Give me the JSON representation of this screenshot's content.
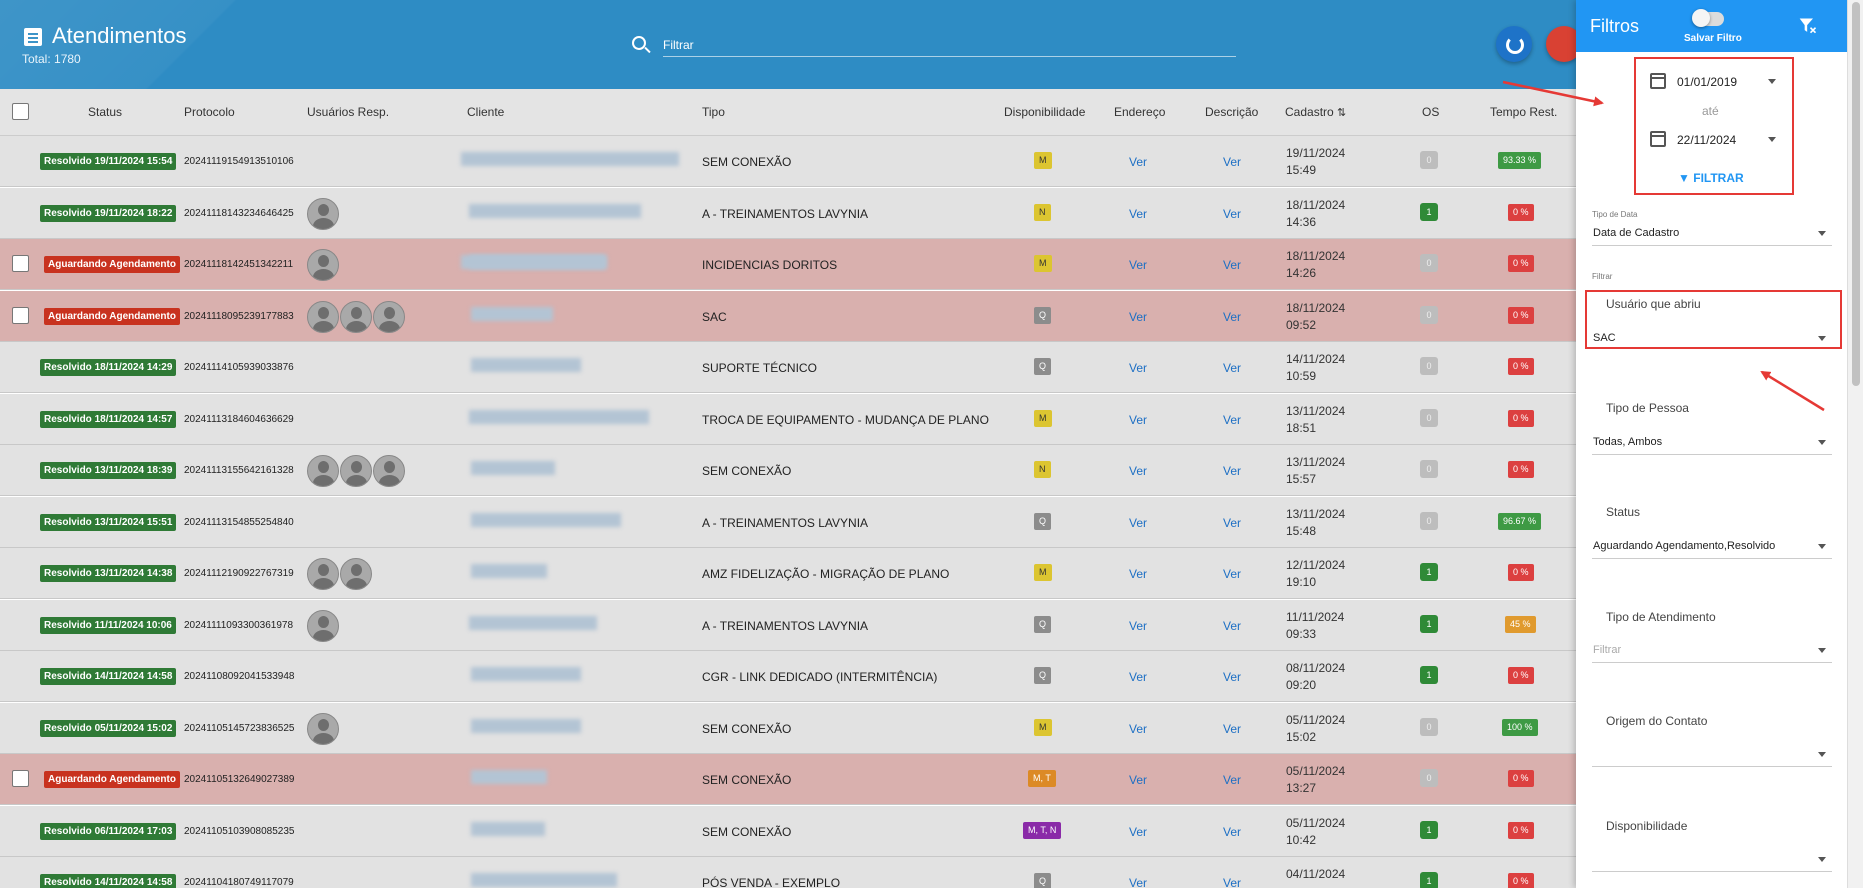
{
  "header": {
    "title": "Atendimentos",
    "total": "Total: 1780",
    "search_placeholder": "Filtrar"
  },
  "columns": {
    "status": "Status",
    "protocolo": "Protocolo",
    "usuarios": "Usuários Resp.",
    "cliente": "Cliente",
    "tipo": "Tipo",
    "disponibilidade": "Disponibilidade",
    "endereco": "Endereço",
    "descricao": "Descrição",
    "cadastro": "Cadastro",
    "os": "OS",
    "tempo": "Tempo Rest."
  },
  "rows": [
    {
      "status": "Resolvido 19/11/2024 15:54",
      "status_color": "green",
      "protocol": "20241119154913510106",
      "avatars": 0,
      "tipo": "SEM CONEXÃO",
      "disp": "M",
      "disp_color": "yellow",
      "endereco": "Ver",
      "descricao": "Ver",
      "date": "19/11/2024",
      "time": "15:49",
      "os": "0",
      "tempo": "93.33 %",
      "tempo_color": "green",
      "highlight": false
    },
    {
      "status": "Resolvido 19/11/2024 18:22",
      "status_color": "green",
      "protocol": "20241118143234646425",
      "avatars": 1,
      "tipo": "A - TREINAMENTOS LAVYNIA",
      "disp": "N",
      "disp_color": "yellow",
      "endereco": "Ver",
      "descricao": "Ver",
      "date": "18/11/2024",
      "time": "14:36",
      "os": "1",
      "tempo": "0 %",
      "tempo_color": "red",
      "highlight": false
    },
    {
      "status": "Aguardando Agendamento",
      "status_color": "red",
      "protocol": "20241118142451342211",
      "avatars": 1,
      "tipo": "INCIDENCIAS DORITOS",
      "disp": "M",
      "disp_color": "yellow",
      "endereco": "Ver",
      "descricao": "Ver",
      "date": "18/11/2024",
      "time": "14:26",
      "os": "0",
      "tempo": "0 %",
      "tempo_color": "red",
      "highlight": true
    },
    {
      "status": "Aguardando Agendamento",
      "status_color": "red",
      "protocol": "20241118095239177883",
      "avatars": 3,
      "tipo": "SAC",
      "disp": "Q",
      "disp_color": "gray",
      "endereco": "Ver",
      "descricao": "Ver",
      "date": "18/11/2024",
      "time": "09:52",
      "os": "0",
      "tempo": "0 %",
      "tempo_color": "red",
      "highlight": true
    },
    {
      "status": "Resolvido 18/11/2024 14:29",
      "status_color": "green",
      "protocol": "20241114105939033876",
      "avatars": 0,
      "tipo": "SUPORTE TÉCNICO",
      "disp": "Q",
      "disp_color": "gray",
      "endereco": "Ver",
      "descricao": "Ver",
      "date": "14/11/2024",
      "time": "10:59",
      "os": "0",
      "tempo": "0 %",
      "tempo_color": "red",
      "highlight": false
    },
    {
      "status": "Resolvido 18/11/2024 14:57",
      "status_color": "green",
      "protocol": "20241113184604636629",
      "avatars": 0,
      "tipo": "TROCA DE EQUIPAMENTO - MUDANÇA DE PLANO",
      "disp": "M",
      "disp_color": "yellow",
      "endereco": "Ver",
      "descricao": "Ver",
      "date": "13/11/2024",
      "time": "18:51",
      "os": "0",
      "tempo": "0 %",
      "tempo_color": "red",
      "highlight": false
    },
    {
      "status": "Resolvido 13/11/2024 18:39",
      "status_color": "green",
      "protocol": "20241113155642161328",
      "avatars": 3,
      "tipo": "SEM CONEXÃO",
      "disp": "N",
      "disp_color": "yellow",
      "endereco": "Ver",
      "descricao": "Ver",
      "date": "13/11/2024",
      "time": "15:57",
      "os": "0",
      "tempo": "0 %",
      "tempo_color": "red",
      "highlight": false
    },
    {
      "status": "Resolvido 13/11/2024 15:51",
      "status_color": "green",
      "protocol": "20241113154855254840",
      "avatars": 0,
      "tipo": "A - TREINAMENTOS LAVYNIA",
      "disp": "Q",
      "disp_color": "gray",
      "endereco": "Ver",
      "descricao": "Ver",
      "date": "13/11/2024",
      "time": "15:48",
      "os": "0",
      "tempo": "96.67 %",
      "tempo_color": "green",
      "highlight": false
    },
    {
      "status": "Resolvido 13/11/2024 14:38",
      "status_color": "green",
      "protocol": "20241112190922767319",
      "avatars": 2,
      "tipo": "AMZ FIDELIZAÇÃO - MIGRAÇÃO DE PLANO",
      "disp": "M",
      "disp_color": "yellow",
      "endereco": "Ver",
      "descricao": "Ver",
      "date": "12/11/2024",
      "time": "19:10",
      "os": "1",
      "tempo": "0 %",
      "tempo_color": "red",
      "highlight": false
    },
    {
      "status": "Resolvido 11/11/2024 10:06",
      "status_color": "green",
      "protocol": "20241111093300361978",
      "avatars": 1,
      "tipo": "A - TREINAMENTOS LAVYNIA",
      "disp": "Q",
      "disp_color": "gray",
      "endereco": "Ver",
      "descricao": "Ver",
      "date": "11/11/2024",
      "time": "09:33",
      "os": "1",
      "tempo": "45 %",
      "tempo_color": "orange",
      "highlight": false
    },
    {
      "status": "Resolvido 14/11/2024 14:58",
      "status_color": "green",
      "protocol": "20241108092041533948",
      "avatars": 0,
      "tipo": "CGR - LINK DEDICADO (INTERMITÊNCIA)",
      "disp": "Q",
      "disp_color": "gray",
      "endereco": "Ver",
      "descricao": "Ver",
      "date": "08/11/2024",
      "time": "09:20",
      "os": "1",
      "tempo": "0 %",
      "tempo_color": "red",
      "highlight": false
    },
    {
      "status": "Resolvido 05/11/2024 15:02",
      "status_color": "green",
      "protocol": "20241105145723836525",
      "avatars": 1,
      "tipo": "SEM CONEXÃO",
      "disp": "M",
      "disp_color": "yellow",
      "endereco": "Ver",
      "descricao": "Ver",
      "date": "05/11/2024",
      "time": "15:02",
      "os": "0",
      "tempo": "100 %",
      "tempo_color": "green",
      "highlight": false
    },
    {
      "status": "Aguardando Agendamento",
      "status_color": "red",
      "protocol": "20241105132649027389",
      "avatars": 0,
      "tipo": "SEM CONEXÃO",
      "disp": "M, T",
      "disp_color": "orange",
      "endereco": "Ver",
      "descricao": "Ver",
      "date": "05/11/2024",
      "time": "13:27",
      "os": "0",
      "tempo": "0 %",
      "tempo_color": "red",
      "highlight": true
    },
    {
      "status": "Resolvido 06/11/2024 17:03",
      "status_color": "green",
      "protocol": "20241105103908085235",
      "avatars": 0,
      "tipo": "SEM CONEXÃO",
      "disp": "M, T, N",
      "disp_color": "purple",
      "endereco": "Ver",
      "descricao": "Ver",
      "date": "05/11/2024",
      "time": "10:42",
      "os": "1",
      "tempo": "0 %",
      "tempo_color": "red",
      "highlight": false
    },
    {
      "status": "Resolvido 14/11/2024 14:58",
      "status_color": "green",
      "protocol": "20241104180749117079",
      "avatars": 0,
      "tipo": "PÓS VENDA - EXEMPLO",
      "disp": "Q",
      "disp_color": "gray",
      "endereco": "Ver",
      "descricao": "Ver",
      "date": "04/11/2024",
      "time": "",
      "os": "1",
      "tempo": "0 %",
      "tempo_color": "red",
      "highlight": false
    }
  ],
  "panel": {
    "title": "Filtros",
    "save_filter": "Salvar Filtro",
    "date_from": "01/01/2019",
    "date_sep": "até",
    "date_to": "22/11/2024",
    "filter_button": "FILTRAR",
    "tipo_data_label": "Tipo de Data",
    "tipo_data_value": "Data de Cadastro",
    "filtrar_label": "Filtrar",
    "usuario_label": "Usuário que abriu",
    "usuario_value": "SAC",
    "tipo_pessoa_label": "Tipo de Pessoa",
    "tipo_pessoa_value": "Todas, Ambos",
    "status_label": "Status",
    "status_value": "Aguardando Agendamento,Resolvido",
    "tipo_atendimento_label": "Tipo de Atendimento",
    "tipo_atendimento_placeholder": "Filtrar",
    "origem_label": "Origem do Contato",
    "disponibilidade_label": "Disponibilidade"
  },
  "colors": {
    "header_blue": "#2e8cc4",
    "panel_blue": "#2196f3",
    "highlight_red": "#e53935"
  }
}
